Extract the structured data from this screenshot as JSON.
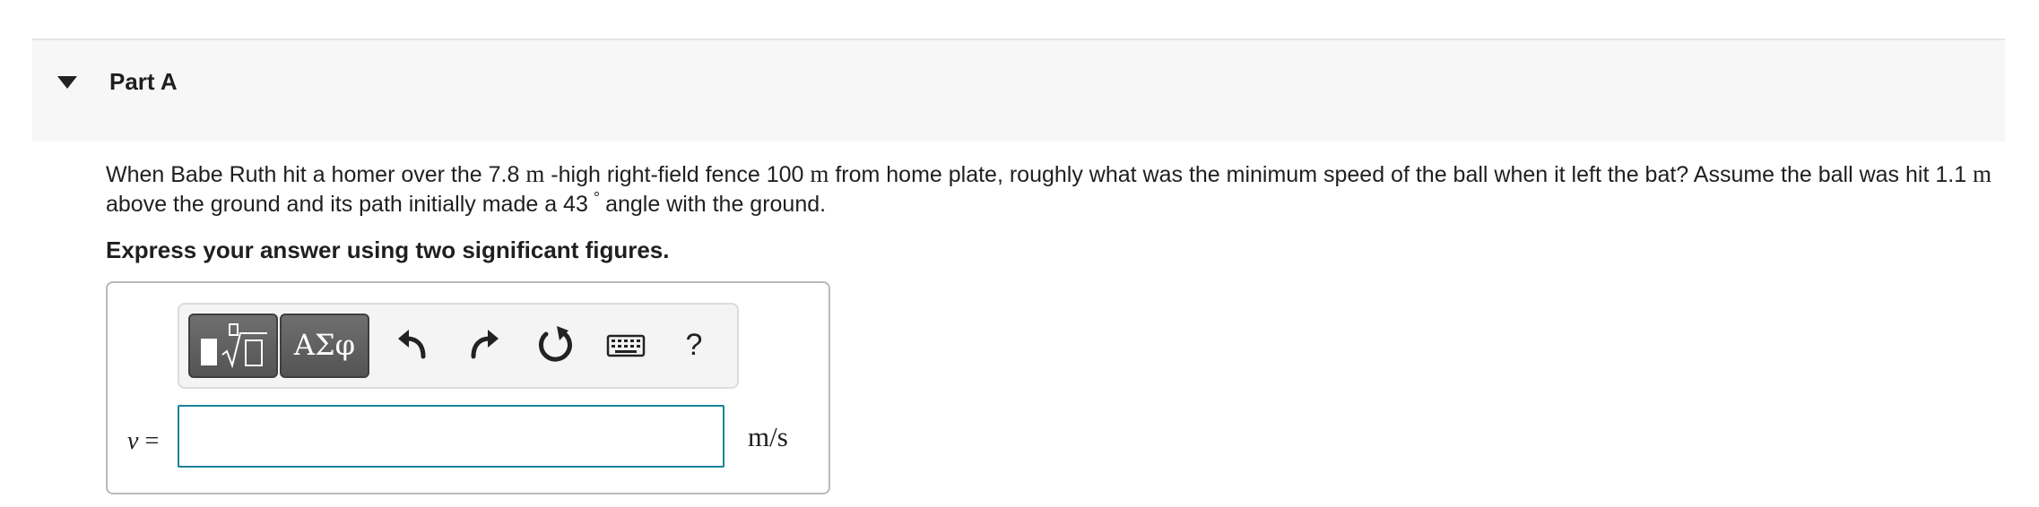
{
  "part": {
    "title": "Part A"
  },
  "question": {
    "text_1": "When Babe Ruth hit a homer over the 7.8 ",
    "unit_1": "m",
    "text_2": " -high right-field fence 100 ",
    "unit_2": "m",
    "text_3": " from home plate, roughly what was the minimum speed of the ball when it left the bat? Assume the ball was hit 1.1 ",
    "unit_3": "m",
    "text_4": " above the ground and its path initially made a 43",
    "degree": "°",
    "text_5": "angle with the ground."
  },
  "instruction": "Express your answer using two significant figures.",
  "toolbar": {
    "symbols_label": "ΑΣφ",
    "help_label": "?",
    "icons": [
      "templates-icon",
      "undo-icon",
      "redo-icon",
      "reset-icon",
      "keyboard-icon",
      "help-icon"
    ]
  },
  "answer": {
    "variable": "v",
    "equals": " =",
    "value": "",
    "units": "m/s"
  },
  "colors": {
    "header_bg": "#f7f7f7",
    "input_border": "#1a8299",
    "toolbar_button": "#5e5e5e"
  }
}
